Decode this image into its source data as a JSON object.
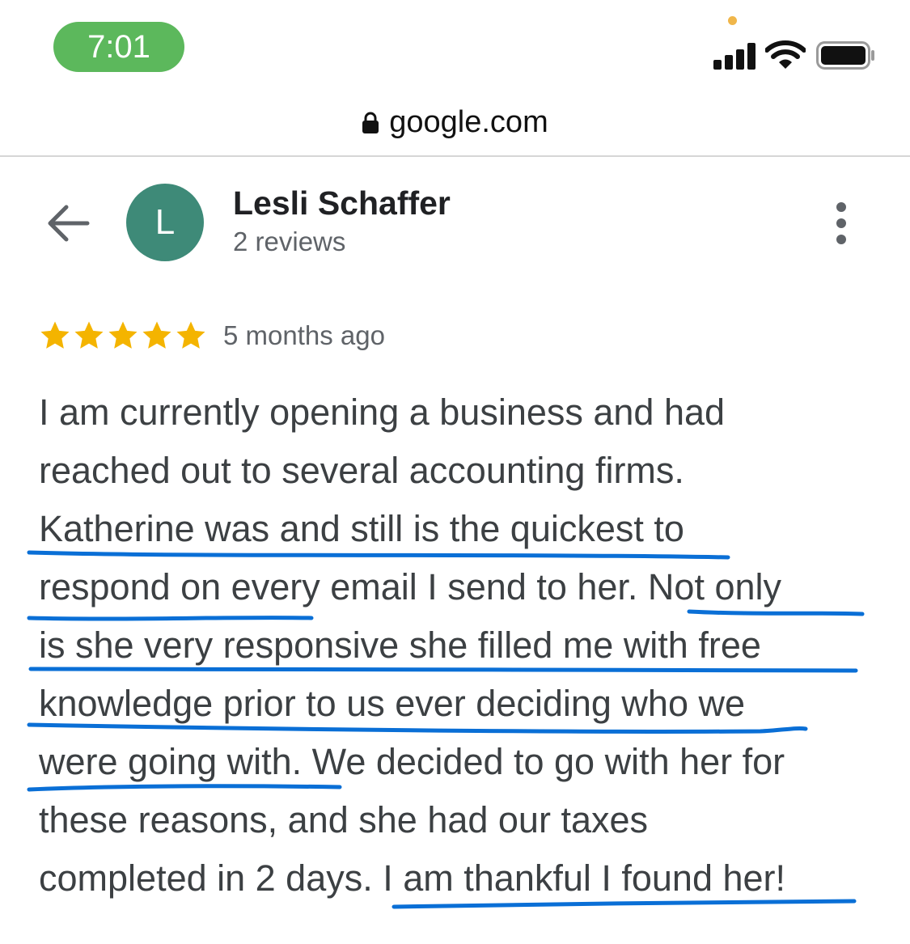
{
  "status_bar": {
    "time": "7:01",
    "time_pill_color": "#5cb85c"
  },
  "address_bar": {
    "domain": "google.com",
    "lock_icon": "lock-icon"
  },
  "header": {
    "back_icon": "arrow-left-icon",
    "avatar_letter": "L",
    "avatar_color": "#3e8a78",
    "author_name": "Lesli Schaffer",
    "review_count": "2 reviews",
    "menu_icon": "more-vert-icon"
  },
  "rating": {
    "stars": 5,
    "max_stars": 5,
    "star_color": "#f4b400",
    "date": "5 months ago"
  },
  "review": {
    "lines": [
      "I am currently opening a business and had",
      "reached out to several accounting firms.",
      "Katherine was and still is the quickest to",
      "respond on every email I send to her. Not only",
      "is she very responsive she filled me with free",
      "knowledge prior to us ever deciding who we",
      "were going with. We decided to go with her for",
      "these reasons, and she had our taxes",
      "completed in 2 days. I am thankful I found her!"
    ],
    "highlight_color": "#0a6fd6"
  }
}
